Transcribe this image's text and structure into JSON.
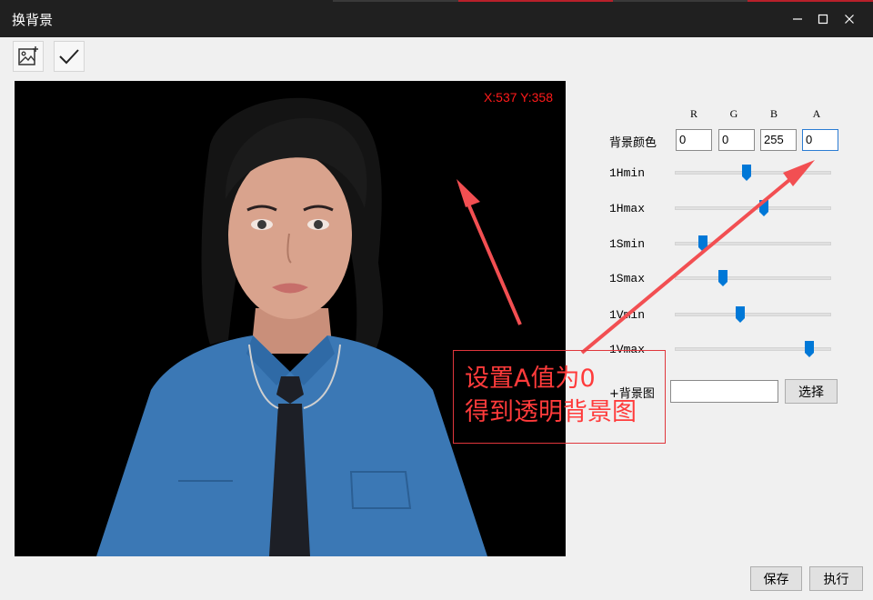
{
  "window": {
    "title": "换背景"
  },
  "canvas": {
    "coord_text": "X:537 Y:358"
  },
  "panel": {
    "columns": [
      "R",
      "G",
      "B",
      "A"
    ],
    "bg_color_label": "背景颜色",
    "values": {
      "r": "0",
      "g": "0",
      "b": "255",
      "a": "0"
    },
    "sliders": [
      {
        "label": "1Hmin",
        "value": 0.46
      },
      {
        "label": "1Hmax",
        "value": 0.57
      },
      {
        "label": "1Smin",
        "value": 0.18
      },
      {
        "label": "1Smax",
        "value": 0.31
      },
      {
        "label": "1Vmin",
        "value": 0.42
      },
      {
        "label": "1Vmax",
        "value": 0.86
      }
    ],
    "bg_image_label": "+背景图",
    "bg_image_value": "",
    "choose_label": "选择"
  },
  "footer": {
    "save_label": "保存",
    "execute_label": "执行"
  },
  "annotation": {
    "line1": "设置A值为0",
    "line2": "得到透明背景图"
  },
  "colors": {
    "accent": "#0078d7",
    "annotation": "#ff3b3b",
    "titlebar": "#202020"
  }
}
